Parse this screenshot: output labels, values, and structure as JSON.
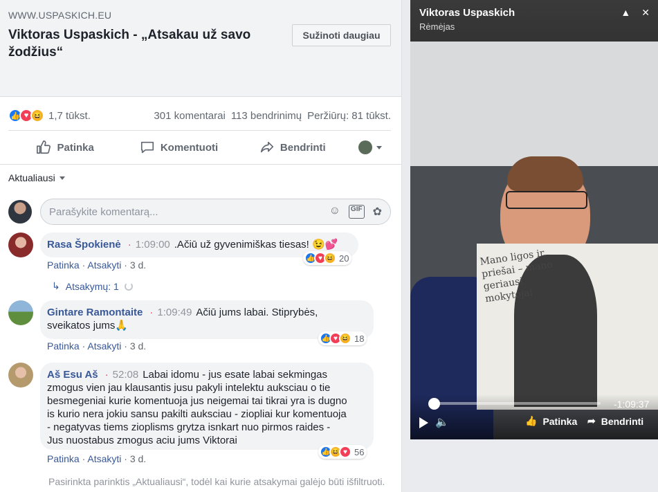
{
  "link_preview": {
    "domain": "WWW.USPASKICH.EU",
    "title": "Viktoras Uspaskich - „Atsakau už savo žodžius“",
    "learn_more": "Sužinoti daugiau"
  },
  "stats": {
    "reactions_count": "1,7 tūkst.",
    "comments": "301 komentarai",
    "shares": "113 bendrinimų",
    "views": "Peržiūrų: 81 tūkst."
  },
  "actions": {
    "like": "Patinka",
    "comment": "Komentuoti",
    "share": "Bendrinti"
  },
  "sort": {
    "label": "Aktualiausi"
  },
  "composer": {
    "placeholder": "Parašykite komentarą..."
  },
  "comments": [
    {
      "author": "Rasa Špokienė",
      "time": "1:09:00",
      "text": ".Ačiū už gyvenimiškas tiesas! 😉💕",
      "reactions": "20",
      "like": "Patinka",
      "reply": "Atsakyti",
      "age": "3 d.",
      "replies": "Atsakymų: 1"
    },
    {
      "author": "Gintare Ramontaite",
      "time": "1:09:49",
      "text_line1": "Ačiū jums labai. Stiprybės,",
      "text_line2": "sveikatos jums🙏",
      "reactions": "18",
      "like": "Patinka",
      "reply": "Atsakyti",
      "age": "3 d."
    },
    {
      "author": "Aš Esu Aš",
      "time": "52:08",
      "lines": [
        "Labai idomu - jus esate labai sekmingas",
        "zmogus vien jau klausantis jusu pakyli intelektu auksciau o tie",
        "besmegeniai kurie komentuoja jus neigemai tai tikrai yra is dugno",
        "is kurio nera jokiu sansu pakilti auksciau - ziopliai kur komentuoja",
        "- negatyvas tiems zioplisms grytza isnkart nuo pirmos raides -",
        "Jus nuostabus zmogus aciu jums Viktorai"
      ],
      "reactions": "56",
      "like": "Patinka",
      "reply": "Atsakyti",
      "age": "3 d."
    }
  ],
  "footnote": "Pasirinkta parinktis „Aktualiausi“, todėl kai kurie atsakymai galėjo būti išfiltruoti.",
  "video": {
    "name": "Viktoras Uspaskich",
    "subtitle": "Rėmėjas",
    "remaining": "-1:09:37",
    "like": "Patinka",
    "share": "Bendrinti",
    "book_title": "Mano ligos ir priešai – mano geriausi mokytojai"
  },
  "colors": {
    "link": "#385898",
    "like_blue": "#1877f2",
    "love_red": "#f33e58",
    "haha_yellow": "#f7b125"
  }
}
